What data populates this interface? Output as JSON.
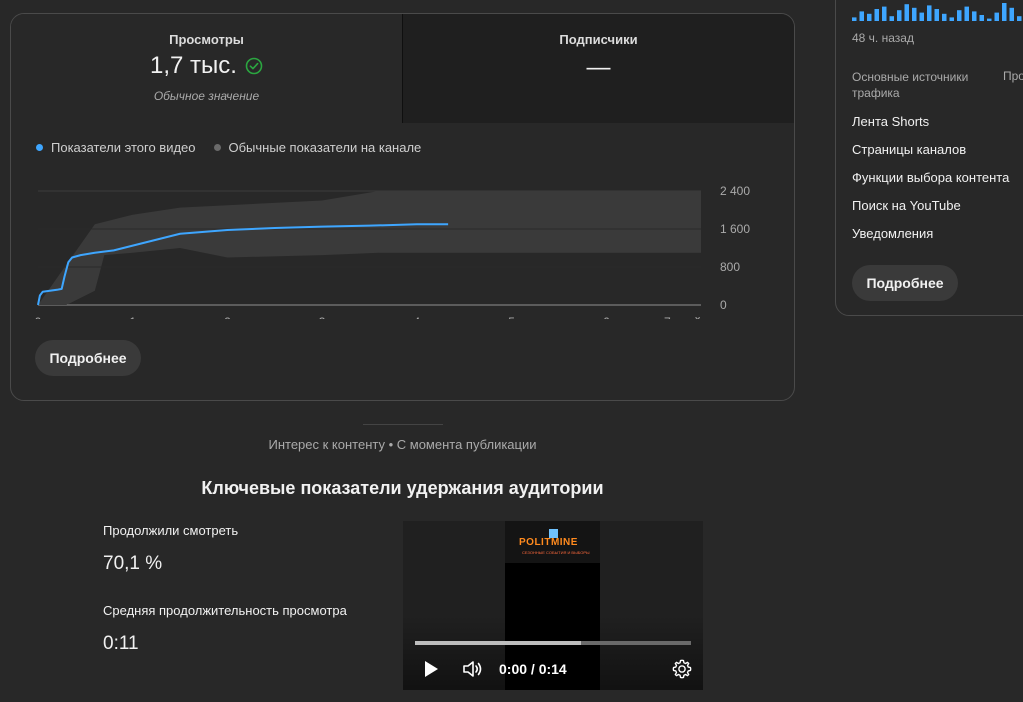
{
  "tabs": {
    "views": {
      "label": "Просмотры",
      "value": "1,7 тыс.",
      "sub": "Обычное значение"
    },
    "subscribers": {
      "label": "Подписчики",
      "value": "—"
    }
  },
  "legend": {
    "this_video": "Показатели этого видео",
    "typical": "Обычные показатели на канале"
  },
  "colors": {
    "accent": "#3ea6ff",
    "band": "#3a3a3a",
    "check": "#2ba640"
  },
  "main_button": "Подробнее",
  "chart_data": {
    "type": "line",
    "x_ticks": [
      "0",
      "1",
      "2",
      "3",
      "4",
      "5",
      "6",
      "7 дней"
    ],
    "y_ticks": [
      "0",
      "800",
      "1 600",
      "2 400"
    ],
    "xlim": [
      0,
      7
    ],
    "ylim": [
      0,
      2400
    ],
    "series": [
      {
        "name": "Показатели этого видео",
        "x": [
          0,
          0.02,
          0.05,
          0.2,
          0.25,
          0.28,
          0.32,
          0.36,
          0.45,
          0.6,
          0.8,
          1.0,
          1.2,
          1.5,
          2.0,
          2.5,
          3.0,
          3.5,
          4.0,
          4.33
        ],
        "y": [
          0,
          200,
          280,
          320,
          340,
          600,
          900,
          1000,
          1050,
          1100,
          1150,
          1250,
          1350,
          1500,
          1580,
          1620,
          1650,
          1670,
          1700,
          1700
        ]
      }
    ],
    "band": {
      "name": "Обычные показатели на канале",
      "x": [
        0,
        0.3,
        0.6,
        0.7,
        1.0,
        1.5,
        2.0,
        3.0,
        3.6,
        4.0,
        5.0,
        6.0,
        7.0
      ],
      "upper": [
        0,
        850,
        1700,
        1750,
        1900,
        2050,
        2100,
        2200,
        2400,
        2400,
        2400,
        2400,
        2400
      ],
      "lower": [
        0,
        0,
        300,
        1050,
        1100,
        1200,
        1000,
        1050,
        1100,
        1100,
        1100,
        1100,
        1100
      ]
    }
  },
  "side": {
    "time": "48 ч. назад",
    "tab1": "Основные источники трафика",
    "tab2": "Про",
    "items": [
      "Лента Shorts",
      "Страницы каналов",
      "Функции выбора контента",
      "Поиск на YouTube",
      "Уведомления"
    ],
    "button": "Подробнее",
    "spark": [
      3,
      8,
      6,
      10,
      12,
      4,
      9,
      14,
      11,
      7,
      13,
      10,
      6,
      3,
      9,
      12,
      8,
      5,
      2,
      7,
      15,
      11,
      4,
      8
    ]
  },
  "section": {
    "subtitle": "Интерес к контенту • С момента публикации",
    "title": "Ключевые показатели удержания аудитории"
  },
  "metrics": {
    "continued_label": "Продолжили смотреть",
    "continued_value": "70,1 %",
    "avg_label": "Средняя продолжительность просмотра",
    "avg_value": "0:11"
  },
  "player": {
    "logo": "POLITMINE",
    "tagline": "СЕЗОННЫЕ СОБЫТИЯ И ВЫБОРЫ",
    "time": "0:00 / 0:14",
    "progress": 0.6
  }
}
